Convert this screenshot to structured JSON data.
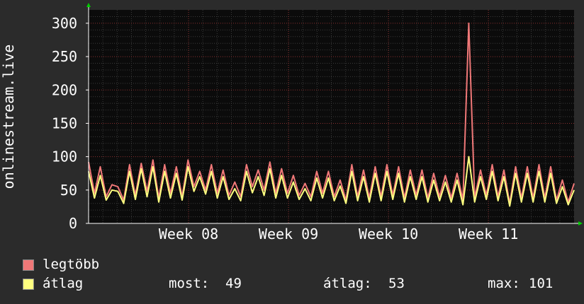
{
  "ylabel": "onlinestream.live",
  "colors": {
    "background": "#2b2b2b",
    "plot_background": "#0b0b0b",
    "grid_minor": "#3a3a3a",
    "grid_major": "#8a3030",
    "axis": "#ffffff",
    "max_line": "#f07878",
    "avg_line": "#ffff80",
    "arrow": "#00cc00"
  },
  "legend": [
    {
      "label": "legtöbb",
      "color": "#f07878"
    },
    {
      "label": "átlag",
      "color": "#ffff80"
    }
  ],
  "stats": {
    "now_label": "most:",
    "now_value": "49",
    "avg_label": "átlag:",
    "avg_value": "53",
    "max_label": "max:",
    "max_value": "101"
  },
  "chart_data": {
    "type": "line",
    "ylim": [
      0,
      320
    ],
    "yticks": [
      0,
      50,
      100,
      150,
      200,
      250,
      300
    ],
    "xlim": [
      0,
      34
    ],
    "xticks": [
      {
        "label": "Week 08",
        "x": 7
      },
      {
        "label": "Week 09",
        "x": 14
      },
      {
        "label": "Week 10",
        "x": 21
      },
      {
        "label": "Week 11",
        "x": 28
      }
    ],
    "grid": true,
    "series": [
      {
        "name": "legtöbb",
        "color": "#f07878",
        "values": [
          92,
          45,
          85,
          40,
          58,
          55,
          35,
          88,
          42,
          90,
          48,
          95,
          38,
          88,
          45,
          85,
          40,
          95,
          55,
          78,
          50,
          88,
          45,
          80,
          42,
          62,
          40,
          88,
          55,
          80,
          50,
          92,
          45,
          82,
          45,
          72,
          42,
          60,
          40,
          78,
          45,
          78,
          40,
          65,
          35,
          88,
          40,
          80,
          38,
          85,
          40,
          88,
          42,
          85,
          38,
          80,
          42,
          80,
          38,
          75,
          40,
          72,
          38,
          75,
          35,
          300,
          38,
          80,
          42,
          88,
          40,
          80,
          30,
          85,
          38,
          85,
          38,
          88,
          38,
          85,
          35,
          65,
          32,
          60
        ]
      },
      {
        "name": "átlag",
        "color": "#ffff80",
        "values": [
          78,
          38,
          72,
          35,
          50,
          48,
          30,
          78,
          36,
          82,
          40,
          85,
          32,
          78,
          38,
          75,
          35,
          85,
          48,
          70,
          44,
          78,
          38,
          70,
          36,
          52,
          34,
          78,
          46,
          70,
          42,
          82,
          38,
          72,
          38,
          62,
          36,
          52,
          34,
          68,
          38,
          68,
          34,
          56,
          30,
          78,
          34,
          70,
          32,
          75,
          34,
          78,
          36,
          75,
          32,
          70,
          36,
          70,
          32,
          65,
          34,
          62,
          32,
          65,
          28,
          100,
          32,
          70,
          36,
          78,
          34,
          70,
          26,
          75,
          32,
          75,
          32,
          78,
          32,
          75,
          30,
          55,
          28,
          50
        ]
      }
    ]
  }
}
